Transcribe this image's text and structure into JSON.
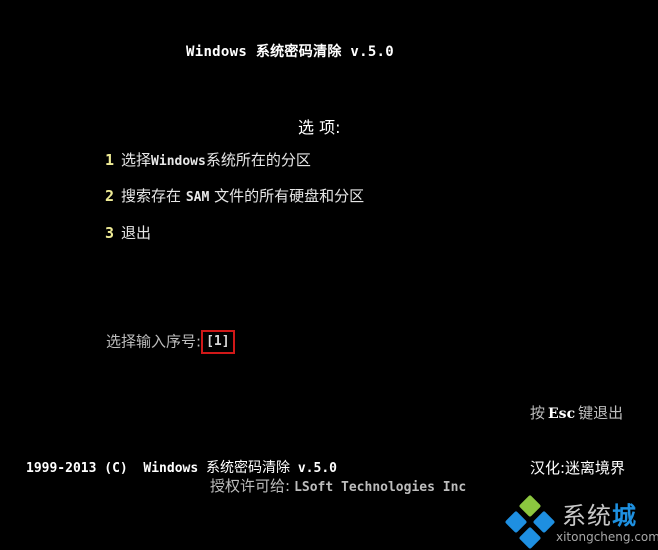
{
  "header": {
    "title": "Windows 系统密码清除 v.5.0"
  },
  "menu": {
    "heading": "选  项:",
    "items": [
      {
        "number": "1",
        "label_pre": "选择",
        "label_mono": "Windows",
        "label_post": "系统所在的分区"
      },
      {
        "number": "2",
        "label_pre": "搜索存在 ",
        "label_mono": "SAM",
        "label_post": " 文件的所有硬盘和分区"
      },
      {
        "number": "3",
        "label_pre": "退出",
        "label_mono": "",
        "label_post": ""
      }
    ]
  },
  "prompt": {
    "label": "选择输入序号:",
    "value": "[1]"
  },
  "esc_hint": {
    "pre": "按",
    "key": "Esc",
    "post": "键退出"
  },
  "translator": "汉化:迷离境界",
  "footer": {
    "copyright_mono": "1999-2013 (C)  Windows ",
    "copyright_cjk": "系统密码清除",
    "copyright_version": " v.5.0",
    "licensed_label": "授权许可给:",
    "licensed_vendor": "LSoft Technologies Inc"
  },
  "watermark": {
    "brand_pre": "系统",
    "brand_highlight": "城",
    "url": "xitongcheng.com",
    "colors": {
      "green": "#8cc63f",
      "blue": "#1e8fe1"
    }
  }
}
